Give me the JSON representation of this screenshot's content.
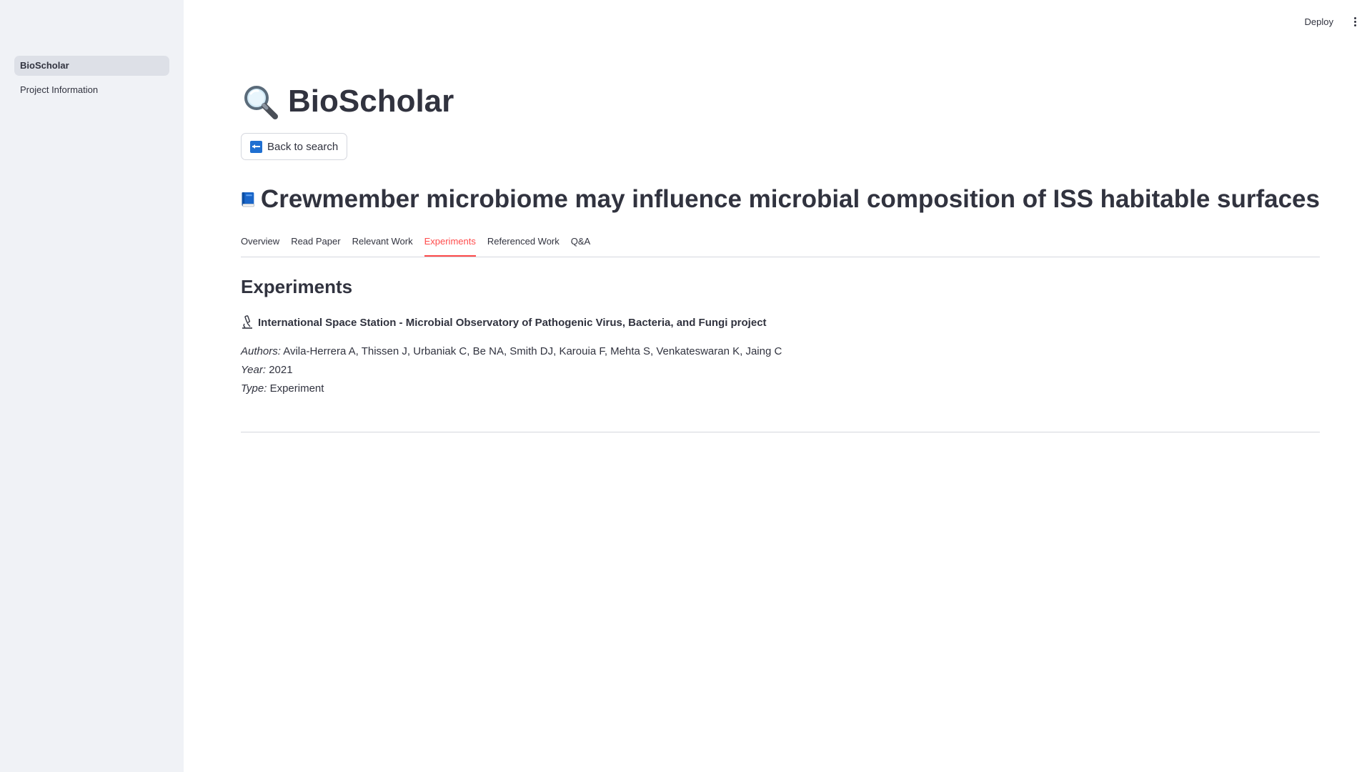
{
  "sidebar": {
    "items": [
      {
        "label": "BioScholar",
        "active": true
      },
      {
        "label": "Project Information",
        "active": false
      }
    ]
  },
  "header": {
    "deploy_label": "Deploy",
    "menu_icon": "kebab-menu-icon"
  },
  "app": {
    "title": "BioScholar",
    "title_icon": "magnifier-icon"
  },
  "back_button": {
    "label": "Back to search",
    "icon": "back-arrow-icon"
  },
  "paper": {
    "title": "Crewmember microbiome may influence microbial composition of ISS habitable surfaces",
    "title_icon": "blue-book-icon"
  },
  "tabs": [
    {
      "label": "Overview",
      "active": false
    },
    {
      "label": "Read Paper",
      "active": false
    },
    {
      "label": "Relevant Work",
      "active": false
    },
    {
      "label": "Experiments",
      "active": true
    },
    {
      "label": "Referenced Work",
      "active": false
    },
    {
      "label": "Q&A",
      "active": false
    }
  ],
  "experiments": {
    "heading": "Experiments",
    "items": [
      {
        "icon": "microscope-icon",
        "title": "International Space Station - Microbial Observatory of Pathogenic Virus, Bacteria, and Fungi project",
        "authors_label": "Authors:",
        "authors": "Avila-Herrera A, Thissen J, Urbaniak C, Be NA, Smith DJ, Karouia F, Mehta S, Venkateswaran K, Jaing C",
        "year_label": "Year:",
        "year": "2021",
        "type_label": "Type:",
        "type": "Experiment"
      }
    ]
  },
  "colors": {
    "sidebar_bg": "#f0f2f6",
    "active_tab": "#ff4b4b",
    "text": "#31333f"
  }
}
